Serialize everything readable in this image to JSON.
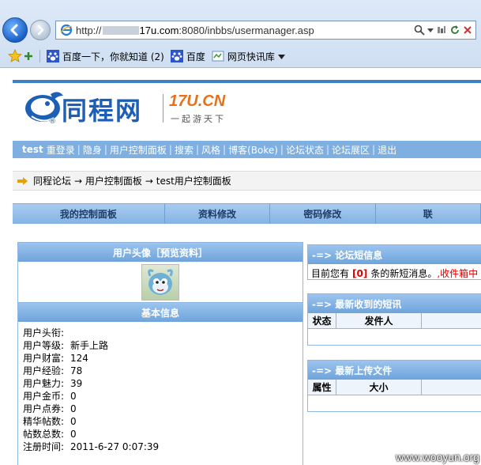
{
  "browser": {
    "url_prefix": "http://",
    "url_host": "17u.com",
    "url_rest": ":8080/inbbs/usermanager.asp",
    "favorites": [
      {
        "label": "百度一下，你就知道 (2)"
      },
      {
        "label": "百度"
      },
      {
        "label": "网页快讯库"
      }
    ]
  },
  "site": {
    "logo_cn": "同程网",
    "logo_reg": "®",
    "logo_en": "17U.CN",
    "slogan": "一起游天下"
  },
  "menu": {
    "user": "test",
    "items": [
      "重登录",
      "隐身",
      "用户控制面板",
      "搜索",
      "风格",
      "博客(Boke)",
      "论坛状态",
      "论坛展区",
      "退出"
    ]
  },
  "breadcrumb": {
    "items": [
      "同程论坛",
      "→ 用户控制面板",
      "→ test用户控制面板"
    ]
  },
  "tabs": [
    "我的控制面板",
    "资料修改",
    "密码修改",
    "联"
  ],
  "left_panel": {
    "avatar_title": "用户头像［预览资料］",
    "basic_title": "基本信息",
    "info": [
      {
        "label": "用户头衔:",
        "value": ""
      },
      {
        "label": "用户等级:",
        "value": "新手上路"
      },
      {
        "label": "用户财富:",
        "value": "124"
      },
      {
        "label": "用户经验:",
        "value": "78"
      },
      {
        "label": "用户魅力:",
        "value": "39"
      },
      {
        "label": "用户金币:",
        "value": "0"
      },
      {
        "label": "用户点券:",
        "value": "0"
      },
      {
        "label": "精华帖数:",
        "value": "0"
      },
      {
        "label": "帖数总数:",
        "value": "0"
      },
      {
        "label": "注册时间:",
        "value": "2011-6-27 0:07:39"
      }
    ]
  },
  "right_panels": {
    "sms_title": "-=> 论坛短信息",
    "sms_prefix": "目前您有",
    "sms_count": "[0]",
    "sms_suffix": "条的新短消息。",
    "sms_link": ",收件箱中",
    "recv_title": "-=> 最新收到的短讯",
    "recv_cols": [
      "状态",
      "发件人"
    ],
    "upload_title": "-=> 最新上传文件",
    "upload_cols": [
      "属性",
      "大小"
    ]
  },
  "watermark": "www.wooyun.org"
}
